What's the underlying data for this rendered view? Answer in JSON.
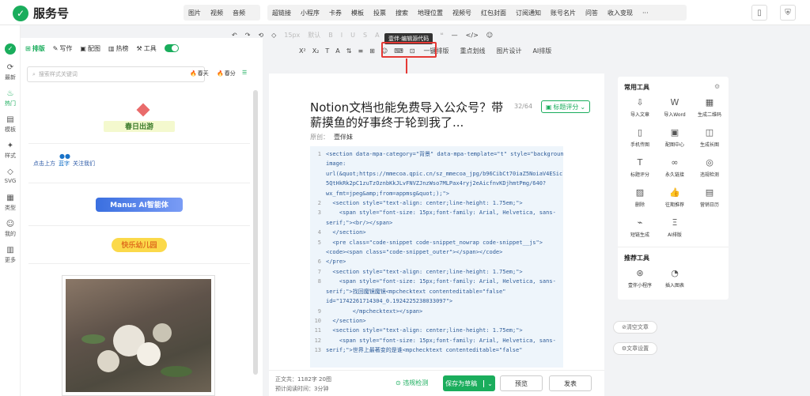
{
  "app": {
    "name": "服务号"
  },
  "top_menu": {
    "group1": [
      "图片",
      "视频",
      "音频"
    ],
    "group2": [
      "超链接",
      "小程序",
      "卡券",
      "模板",
      "投票",
      "搜索",
      "地理位置",
      "视频号",
      "红包封面",
      "订阅通知",
      "账号名片",
      "问答",
      "收入变现",
      "···"
    ]
  },
  "left_rail": [
    "最新",
    "热门",
    "模板",
    "样式",
    "SVG",
    "类型",
    "我的",
    "更多"
  ],
  "left_panel": {
    "tabs": [
      "排版",
      "写作",
      "配图",
      "热榜",
      "工具"
    ],
    "search_placeholder": "搜索样式关键词",
    "chips": [
      "春天",
      "春分"
    ],
    "cards": [
      "春日出游",
      "点击上方",
      "蓝字",
      "关注我们",
      "Manus AI智能体",
      "快乐幼儿园"
    ]
  },
  "toolbar": {
    "row1": [
      "↶",
      "↷",
      "⟲",
      "◇",
      "15px",
      "默认",
      "B",
      "I",
      "U",
      "S",
      "A",
      "≡",
      "≡",
      "≡",
      "≡",
      "❝",
      "—",
      "</>",
      "☺"
    ],
    "row2": [
      "X²",
      "X₂",
      "T",
      "A",
      "⇅",
      "≡",
      "⊞",
      "☺",
      "⌨",
      "⊡",
      "一键排版",
      "重点划线",
      "图片设计",
      "AI排版"
    ],
    "tooltip": "壹伴·编辑源代码"
  },
  "article": {
    "title": "Notion文档也能免费导入公众号？带薪摸鱼的好事终于轮到我了...",
    "count": "32/64",
    "score_button": "标题评分",
    "author_label": "原创：",
    "author": "壹伴妹"
  },
  "code_lines": [
    {
      "n": "1",
      "t": "<section data-mpa-category=\"背景\" data-mpa-template=\"t\" style=\"background-"
    },
    {
      "n": "",
      "t": "image:"
    },
    {
      "n": "",
      "t": "url(&quot;https://mmecoa.qpic.cn/sz_mmecoa_jpg/b96CibCt70iaZ5NoiaV4ESiclelnI6"
    },
    {
      "n": "",
      "t": "5QtHkRk2pC1zuTzOznbKkJLvFNVZJnzWso7MLPax4ryj2eAicfnvKDjhmtPmg/640?"
    },
    {
      "n": "",
      "t": "wx_fmt=jpeg&amp;from=appmsg&quot;);\">"
    },
    {
      "n": "2",
      "t": "  <section style=\"text-align: center;line-height: 1.75em;\">"
    },
    {
      "n": "3",
      "t": "    <span style=\"font-size: 15px;font-family: Arial, Helvetica, sans-"
    },
    {
      "n": "",
      "t": "serif;\"><br/></span>"
    },
    {
      "n": "4",
      "t": "  </section>"
    },
    {
      "n": "5",
      "t": "  <pre class=\"code-snippet code-snippet_nowrap code-snippet__js\">"
    },
    {
      "n": "",
      "t": "<code><span class=\"code-snippet_outer\"></span></code>"
    },
    {
      "n": "6",
      "t": "</pre>"
    },
    {
      "n": "7",
      "t": "  <section style=\"text-align: center;line-height: 1.75em;\">"
    },
    {
      "n": "8",
      "t": "    <span style=\"font-size: 15px;font-family: Arial, Helvetica, sans-"
    },
    {
      "n": "",
      "t": "serif;\">找回魔镜魔镜<mpchecktext contenteditable=\"false\""
    },
    {
      "n": "",
      "t": "id=\"1742261714304_0.1924225238033097\">"
    },
    {
      "n": "9",
      "t": "        </mpchecktext></span>"
    },
    {
      "n": "10",
      "t": "  </section>"
    },
    {
      "n": "11",
      "t": "  <section style=\"text-align: center;line-height: 1.75em;\">"
    },
    {
      "n": "12",
      "t": "    <span style=\"font-size: 15px;font-family: Arial, Helvetica, sans-"
    },
    {
      "n": "13",
      "t": "serif;\">世界上最著变的是谁<mpchecktext contenteditable=\"false\""
    }
  ],
  "footer": {
    "stat1": "正文共：1182字 20图",
    "stat2": "预计阅读时间：3分钟",
    "check": "违规检测",
    "save": "保存为草稿",
    "preview": "预览",
    "publish": "发表"
  },
  "right_panel": {
    "common_title": "常用工具",
    "common_tools": [
      {
        "label": "导入文章",
        "icon": "⇩"
      },
      {
        "label": "导入Word",
        "icon": "W"
      },
      {
        "label": "生成二维码",
        "icon": "▦"
      },
      {
        "label": "手机传图",
        "icon": "▯"
      },
      {
        "label": "配图中心",
        "icon": "▣"
      },
      {
        "label": "生成长图",
        "icon": "◫"
      },
      {
        "label": "标题评分",
        "icon": "T"
      },
      {
        "label": "永久链接",
        "icon": "∞"
      },
      {
        "label": "违规检测",
        "icon": "◎"
      },
      {
        "label": "删除",
        "icon": "▨"
      },
      {
        "label": "往期推荐",
        "icon": "👍"
      },
      {
        "label": "营销日历",
        "icon": "▤"
      },
      {
        "label": "短链生成",
        "icon": "⌁"
      },
      {
        "label": "AI排版",
        "icon": "Ξ"
      }
    ],
    "rec_title": "推荐工具",
    "rec_tools": [
      {
        "label": "壹伴小程序",
        "icon": "⊛"
      },
      {
        "label": "插入图表",
        "icon": "◔"
      }
    ],
    "clear_button": "清空文章",
    "settings_button": "文章设置"
  },
  "colors": {
    "accent": "#1aad5c",
    "highlight": "#e53935"
  }
}
